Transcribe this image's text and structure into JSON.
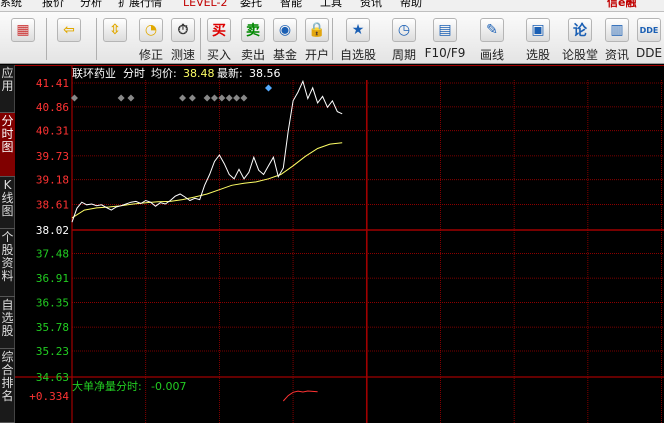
{
  "menu": [
    "系统",
    "报价",
    "分析",
    "扩展行情",
    "LEVEL-2",
    "委托",
    "智能",
    "工具",
    "资讯",
    "帮助"
  ],
  "brand": "信e融",
  "toolbar": {
    "items": [
      {
        "name": "color-scheme",
        "label": "",
        "icon": "▦",
        "color": "#cc3333"
      },
      {
        "name": "back",
        "label": "",
        "icon": "⇦",
        "color": "#e0a800"
      },
      {
        "name": "updown",
        "label": "",
        "icon": "⇳",
        "color": "#e0a800"
      },
      {
        "name": "xiuzheng",
        "label": "修正",
        "icon": "◔",
        "color": "#e0a800"
      },
      {
        "name": "cesu",
        "label": "测速",
        "icon": "⏱",
        "color": "#333333"
      },
      {
        "name": "buy",
        "label": "买入",
        "icon": "买",
        "color": "#dd0000"
      },
      {
        "name": "sell",
        "label": "卖出",
        "icon": "卖",
        "color": "#008800"
      },
      {
        "name": "fund",
        "label": "基金",
        "icon": "◉",
        "color": "#1a5fb4"
      },
      {
        "name": "open-account",
        "label": "开户",
        "icon": "🔒",
        "color": "#b07d00"
      },
      {
        "name": "watchlist",
        "label": "自选股",
        "icon": "★",
        "color": "#1a5fb4"
      },
      {
        "name": "period",
        "label": "周期",
        "icon": "◷",
        "color": "#1a5fb4"
      },
      {
        "name": "f10",
        "label": "F10/F9",
        "icon": "▤",
        "color": "#1a5fb4"
      },
      {
        "name": "draw",
        "label": "画线",
        "icon": "✎",
        "color": "#1a5fb4"
      },
      {
        "name": "screen",
        "label": "选股",
        "icon": "▣",
        "color": "#1a5fb4"
      },
      {
        "name": "forum",
        "label": "论股堂",
        "icon": "论",
        "color": "#1a5fb4"
      },
      {
        "name": "news",
        "label": "资讯",
        "icon": "▥",
        "color": "#1a5fb4"
      },
      {
        "name": "dde",
        "label": "DDE",
        "icon": "DDE",
        "color": "#1a5fb4"
      }
    ]
  },
  "sidebar": [
    "应用",
    "分时图",
    "K线图",
    "个股资料",
    "自选股",
    "综合排名"
  ],
  "stock": {
    "name": "联环药业",
    "mode": "分时",
    "avg_label": "均价:",
    "avg_value": "38.48",
    "last_label": "最新:",
    "last_value": "38.56"
  },
  "colors": {
    "grid": "#a00000",
    "price_up": "#ff3333",
    "price_base": "#ffffff",
    "price_down": "#22cc22",
    "price_line": "#ffffff",
    "avg_line": "#ffff66",
    "marker": "#888888",
    "marker_hl": "#55aaff",
    "sub_title": "#22cc22",
    "sub_line": "#ff3333"
  },
  "chart_data": {
    "type": "line",
    "title": "联环药业 分时",
    "y_ticks": [
      "41.41",
      "40.86",
      "40.31",
      "39.73",
      "39.18",
      "38.61",
      "38.02",
      "37.48",
      "36.91",
      "36.35",
      "35.78",
      "35.23",
      "34.63"
    ],
    "base_price": 38.02,
    "ylim": [
      34.63,
      41.41
    ],
    "x_total": 241,
    "series": [
      {
        "name": "price",
        "x": [
          0,
          2,
          4,
          6,
          8,
          10,
          12,
          14,
          16,
          18,
          20,
          22,
          24,
          26,
          28,
          30,
          32,
          34,
          36,
          38,
          40,
          42,
          44,
          46,
          48,
          50,
          52,
          54,
          56,
          58,
          60,
          62,
          64,
          66,
          68,
          70,
          72,
          74,
          76,
          78,
          80,
          82,
          84,
          86,
          88,
          90,
          92,
          94,
          96,
          98,
          100,
          102,
          104,
          106,
          108,
          110
        ],
        "y": [
          38.2,
          38.52,
          38.66,
          38.6,
          38.62,
          38.58,
          38.6,
          38.54,
          38.48,
          38.55,
          38.58,
          38.62,
          38.66,
          38.68,
          38.63,
          38.7,
          38.66,
          38.57,
          38.65,
          38.62,
          38.7,
          38.8,
          38.85,
          38.78,
          38.7,
          38.75,
          38.72,
          39.05,
          39.3,
          39.6,
          39.75,
          39.55,
          39.3,
          39.2,
          39.42,
          39.2,
          39.35,
          39.7,
          39.4,
          39.3,
          39.5,
          39.7,
          39.25,
          39.45,
          40.3,
          41.0,
          41.2,
          41.45,
          41.05,
          41.3,
          40.95,
          41.1,
          40.85,
          41.0,
          40.75,
          40.7
        ]
      },
      {
        "name": "avg",
        "x": [
          0,
          5,
          10,
          15,
          20,
          25,
          30,
          35,
          40,
          45,
          50,
          55,
          60,
          65,
          70,
          75,
          80,
          85,
          90,
          95,
          100,
          105,
          110
        ],
        "y": [
          38.3,
          38.48,
          38.53,
          38.55,
          38.58,
          38.62,
          38.65,
          38.67,
          38.68,
          38.72,
          38.78,
          38.85,
          38.95,
          39.05,
          39.1,
          39.13,
          39.2,
          39.3,
          39.5,
          39.72,
          39.9,
          40.0,
          40.03
        ]
      }
    ],
    "markers": [
      {
        "x": 1,
        "type": "diamond"
      },
      {
        "x": 20,
        "type": "diamond"
      },
      {
        "x": 24,
        "type": "diamond"
      },
      {
        "x": 45,
        "type": "diamond"
      },
      {
        "x": 49,
        "type": "diamond"
      },
      {
        "x": 55,
        "type": "diamond"
      },
      {
        "x": 58,
        "type": "diamond"
      },
      {
        "x": 61,
        "type": "diamond"
      },
      {
        "x": 64,
        "type": "diamond"
      },
      {
        "x": 67,
        "type": "diamond"
      },
      {
        "x": 70,
        "type": "diamond"
      },
      {
        "x": 80,
        "type": "diamond-up"
      }
    ],
    "sub": {
      "title": "大单净量分时:",
      "value": "-0.007",
      "y_label": "+0.334",
      "x": [
        86,
        88,
        90,
        92,
        94,
        96,
        98,
        100
      ],
      "y": [
        0.0,
        0.18,
        0.29,
        0.33,
        0.3,
        0.334,
        0.32,
        0.31
      ]
    }
  }
}
